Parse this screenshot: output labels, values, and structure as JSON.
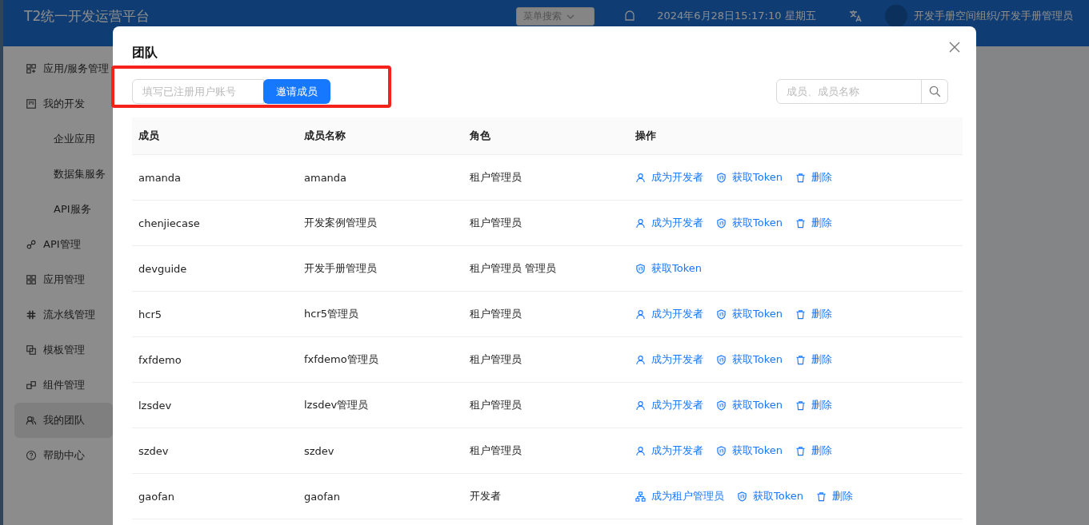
{
  "header": {
    "title": "T2统一开发运营平台",
    "menu_search": {
      "placeholder": "菜单搜索"
    },
    "datetime": "2024年6月28日15:17:10 星期五",
    "user": "开发手册空间组织/开发手册管理员"
  },
  "sidebar": {
    "items": [
      {
        "label": "应用/服务管理",
        "selected": false
      },
      {
        "label": "我的开发",
        "selected": false,
        "children": [
          {
            "label": "企业应用",
            "selected": false
          },
          {
            "label": "数据集服务",
            "selected": false
          },
          {
            "label": "API服务",
            "selected": false
          }
        ]
      },
      {
        "label": "API管理",
        "selected": false
      },
      {
        "label": "应用管理",
        "selected": false
      },
      {
        "label": "流水线管理",
        "selected": false
      },
      {
        "label": "模板管理",
        "selected": false
      },
      {
        "label": "组件管理",
        "selected": false
      },
      {
        "label": "我的团队",
        "selected": true
      },
      {
        "label": "帮助中心",
        "selected": false
      }
    ]
  },
  "dialog": {
    "title": "团队",
    "invite": {
      "placeholder": "填写已注册用户账号",
      "button": "邀请成员"
    },
    "search": {
      "placeholder": "成员、成员名称"
    },
    "table": {
      "columns": [
        "成员",
        "成员名称",
        "角色",
        "操作"
      ],
      "rows": [
        {
          "member": "amanda",
          "name": "amanda",
          "role": "租户管理员",
          "actions": [
            {
              "kind": "developer",
              "label": "成为开发者"
            },
            {
              "kind": "token",
              "label": "获取Token"
            },
            {
              "kind": "delete",
              "label": "删除"
            }
          ]
        },
        {
          "member": "chenjiecase",
          "name": "开发案例管理员",
          "role": "租户管理员",
          "actions": [
            {
              "kind": "developer",
              "label": "成为开发者"
            },
            {
              "kind": "token",
              "label": "获取Token"
            },
            {
              "kind": "delete",
              "label": "删除"
            }
          ]
        },
        {
          "member": "devguide",
          "name": "开发手册管理员",
          "role": "租户管理员 管理员",
          "actions": [
            {
              "kind": "token",
              "label": "获取Token"
            }
          ]
        },
        {
          "member": "hcr5",
          "name": "hcr5管理员",
          "role": "租户管理员",
          "actions": [
            {
              "kind": "developer",
              "label": "成为开发者"
            },
            {
              "kind": "token",
              "label": "获取Token"
            },
            {
              "kind": "delete",
              "label": "删除"
            }
          ]
        },
        {
          "member": "fxfdemo",
          "name": "fxfdemo管理员",
          "role": "租户管理员",
          "actions": [
            {
              "kind": "developer",
              "label": "成为开发者"
            },
            {
              "kind": "token",
              "label": "获取Token"
            },
            {
              "kind": "delete",
              "label": "删除"
            }
          ]
        },
        {
          "member": "lzsdev",
          "name": "lzsdev管理员",
          "role": "租户管理员",
          "actions": [
            {
              "kind": "developer",
              "label": "成为开发者"
            },
            {
              "kind": "token",
              "label": "获取Token"
            },
            {
              "kind": "delete",
              "label": "删除"
            }
          ]
        },
        {
          "member": "szdev",
          "name": "szdev",
          "role": "租户管理员",
          "actions": [
            {
              "kind": "developer",
              "label": "成为开发者"
            },
            {
              "kind": "token",
              "label": "获取Token"
            },
            {
              "kind": "delete",
              "label": "删除"
            }
          ]
        },
        {
          "member": "gaofan",
          "name": "gaofan",
          "role": "开发者",
          "actions": [
            {
              "kind": "admin",
              "label": "成为租户管理员"
            },
            {
              "kind": "token",
              "label": "获取Token"
            },
            {
              "kind": "delete",
              "label": "删除"
            }
          ]
        }
      ]
    }
  }
}
